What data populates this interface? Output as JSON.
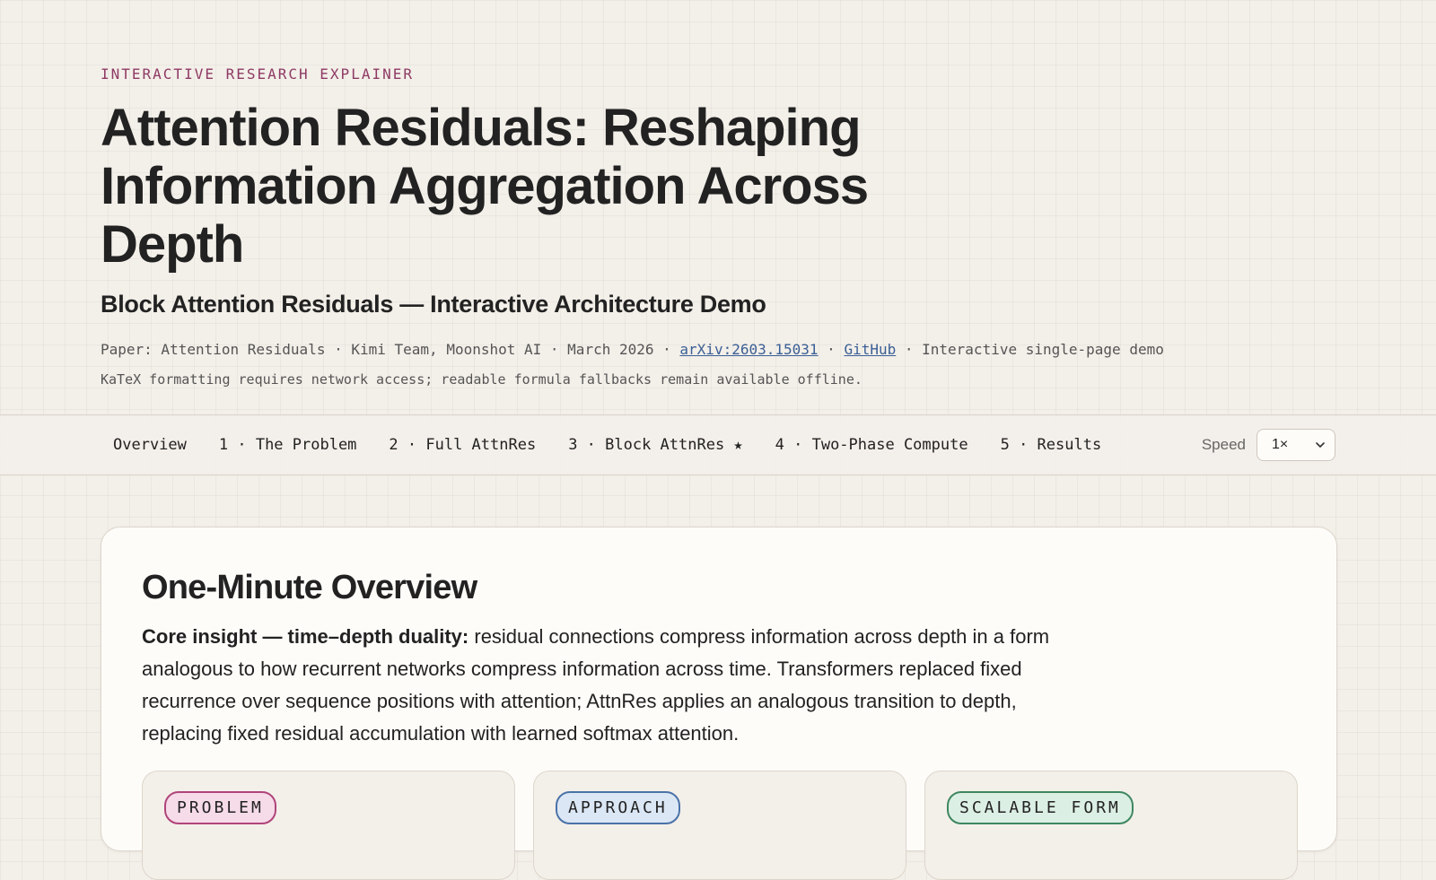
{
  "header": {
    "eyebrow": "INTERACTIVE RESEARCH EXPLAINER",
    "title": "Attention Residuals: Reshaping Information Aggregation Across Depth",
    "subtitle": "Block Attention Residuals — Interactive Architecture Demo",
    "meta_prefix": "Paper: Attention Residuals · Kimi Team, Moonshot AI · March 2026 · ",
    "arxiv_link": "arXiv:2603.15031",
    "meta_sep": " · ",
    "github_link": "GitHub",
    "meta_suffix": " · Interactive single-page demo",
    "note": "KaTeX formatting requires network access; readable formula fallbacks remain available offline."
  },
  "nav": {
    "tabs": [
      {
        "label": "Overview"
      },
      {
        "label": "1 · The Problem"
      },
      {
        "label": "2 · Full AttnRes"
      },
      {
        "label": "3 · Block AttnRes ★"
      },
      {
        "label": "4 · Two-Phase Compute"
      },
      {
        "label": "5 · Results"
      }
    ],
    "speed_label": "Speed",
    "speed_value": "1×"
  },
  "overview": {
    "title": "One-Minute Overview",
    "insight_lead": "Core insight — time–depth duality:",
    "insight_text": " residual connections compress information across depth in a form analogous to how recurrent networks compress information across time. Transformers replaced fixed recurrence over sequence positions with attention; AttnRes applies an analogous transition to depth, replacing fixed residual accumulation with learned softmax attention.",
    "cards": [
      {
        "tag": "PROBLEM"
      },
      {
        "tag": "APPROACH"
      },
      {
        "tag": "SCALABLE FORM"
      }
    ]
  },
  "colors": {
    "accent": "#8e3a64",
    "link": "#3a5f95",
    "problem": "#b0447a",
    "approach": "#4b72a8",
    "scalable": "#3e8760"
  }
}
